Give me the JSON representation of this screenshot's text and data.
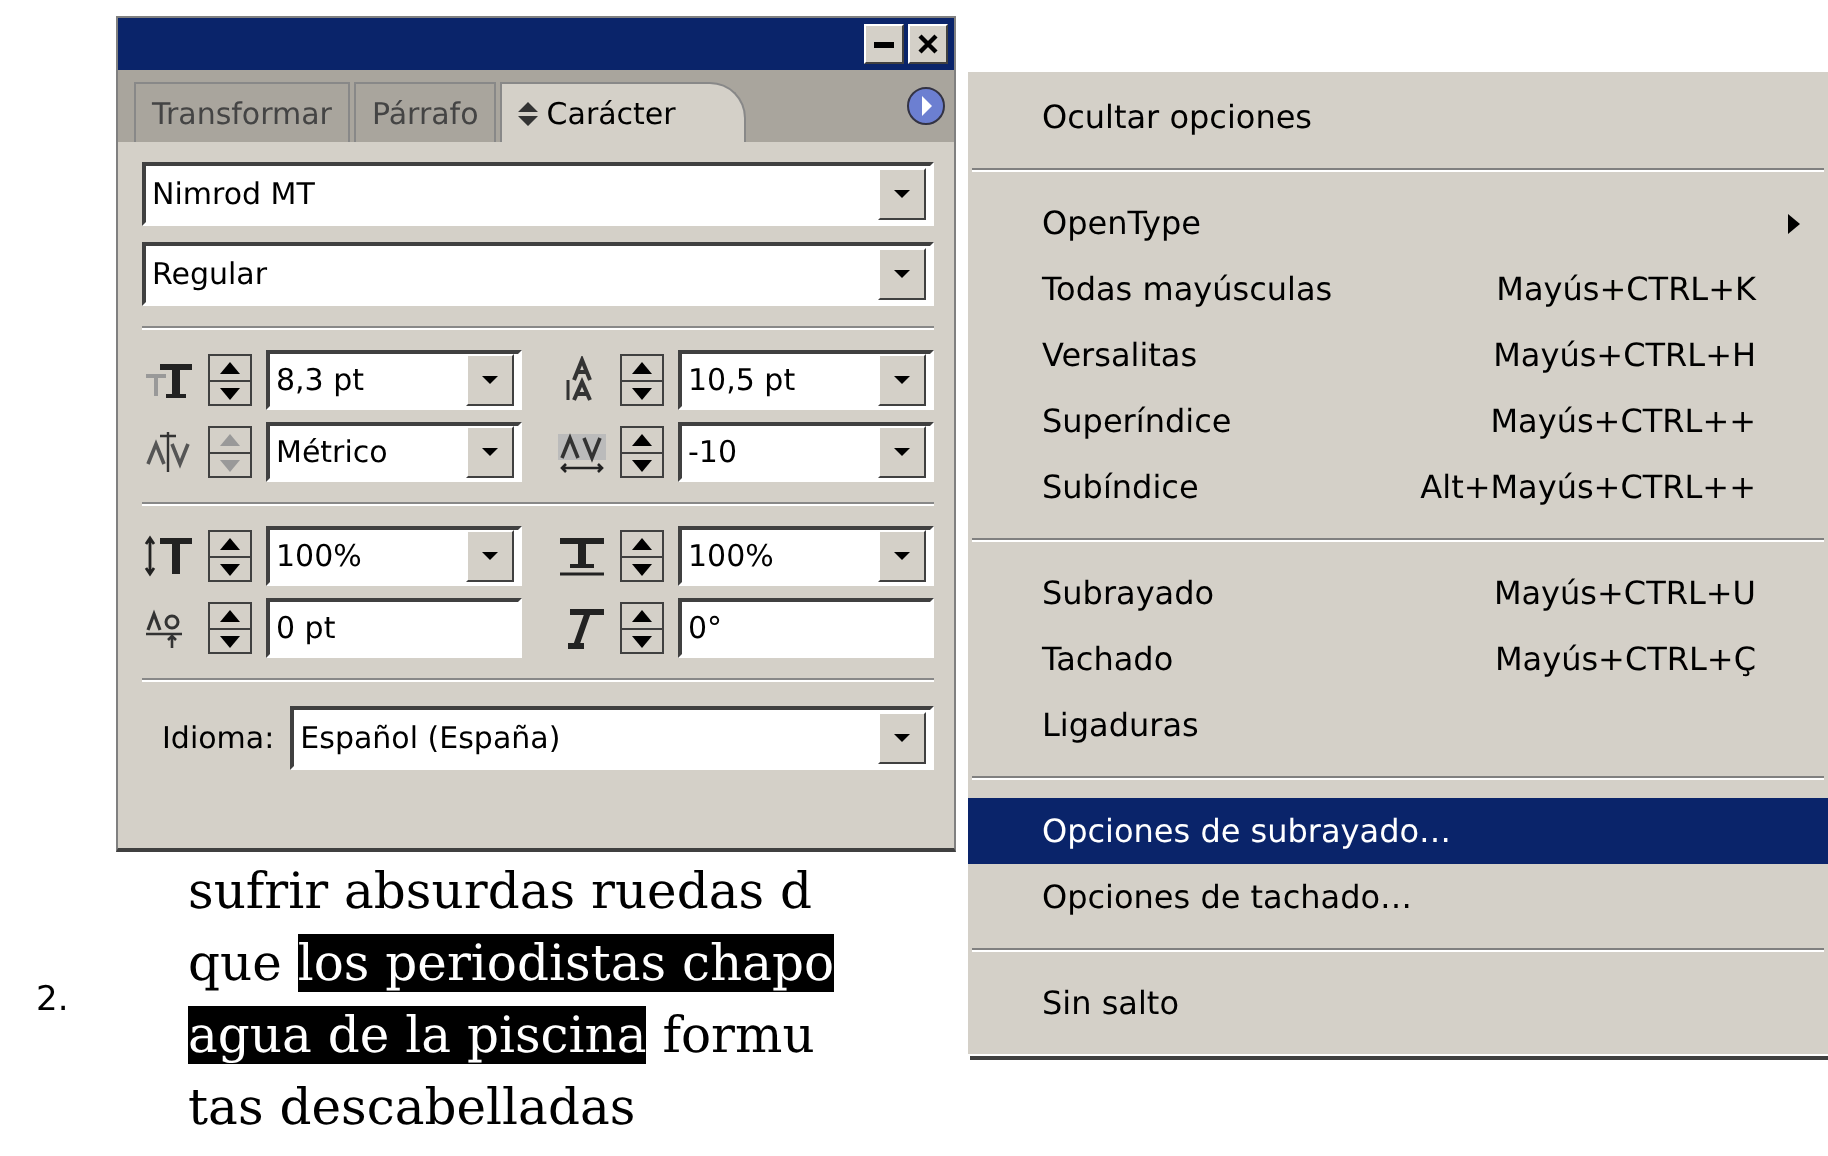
{
  "panel": {
    "tabs": [
      {
        "label": "Transformar",
        "selected": false
      },
      {
        "label": "Párrafo",
        "selected": false
      },
      {
        "label": "Carácter",
        "selected": true
      }
    ],
    "font_family": {
      "value": "Nimrod MT"
    },
    "font_style": {
      "value": "Regular"
    },
    "metric_groups": [
      [
        {
          "kind": "size",
          "value": "8,3 pt",
          "dropdown": true,
          "disabled": false
        },
        {
          "kind": "leading",
          "value": "10,5 pt",
          "dropdown": true,
          "disabled": false
        },
        {
          "kind": "kerning",
          "value": "Métrico",
          "dropdown": true,
          "disabled": true
        },
        {
          "kind": "tracking",
          "value": "-10",
          "dropdown": true,
          "disabled": false
        }
      ],
      [
        {
          "kind": "vscale",
          "value": "100%",
          "dropdown": true,
          "disabled": false
        },
        {
          "kind": "hscale",
          "value": "100%",
          "dropdown": true,
          "disabled": false
        },
        {
          "kind": "baseline",
          "value": "0 pt",
          "dropdown": false,
          "disabled": false
        },
        {
          "kind": "skew",
          "value": "0°",
          "dropdown": false,
          "disabled": false
        }
      ]
    ],
    "language": {
      "label": "Idioma:",
      "value": "Español (España)"
    }
  },
  "menu": {
    "groups": [
      [
        {
          "label": "Ocultar opciones",
          "selected": false
        }
      ],
      [
        {
          "label": "OpenType",
          "submenu": true,
          "selected": false
        },
        {
          "label": "Todas mayúsculas",
          "shortcut": "Mayús+CTRL+K",
          "selected": false
        },
        {
          "label": "Versalitas",
          "shortcut": "Mayús+CTRL+H",
          "selected": false
        },
        {
          "label": "Superíndice",
          "shortcut": "Mayús+CTRL++",
          "selected": false
        },
        {
          "label": "Subíndice",
          "shortcut": "Alt+Mayús+CTRL++",
          "selected": false
        }
      ],
      [
        {
          "label": "Subrayado",
          "shortcut": "Mayús+CTRL+U",
          "selected": false
        },
        {
          "label": "Tachado",
          "shortcut": "Mayús+CTRL+Ç",
          "selected": false
        },
        {
          "label": "Ligaduras",
          "selected": false
        }
      ],
      [
        {
          "label": "Opciones de subrayado…",
          "selected": true
        },
        {
          "label": "Opciones de tachado…",
          "selected": false
        }
      ],
      [
        {
          "label": "Sin salto",
          "selected": false
        }
      ]
    ]
  },
  "document": {
    "list_number": "2.",
    "lines": [
      [
        {
          "text": "sufrir absurdas ruedas d",
          "highlighted": false
        }
      ],
      [
        {
          "text": "que ",
          "highlighted": false
        },
        {
          "text": "los periodistas chapo",
          "highlighted": true
        }
      ],
      [
        {
          "text": "agua de la piscina",
          "highlighted": true
        },
        {
          "text": " formu",
          "highlighted": false
        }
      ],
      [
        {
          "text": "tas descabelladas",
          "highlighted": false
        }
      ]
    ]
  }
}
